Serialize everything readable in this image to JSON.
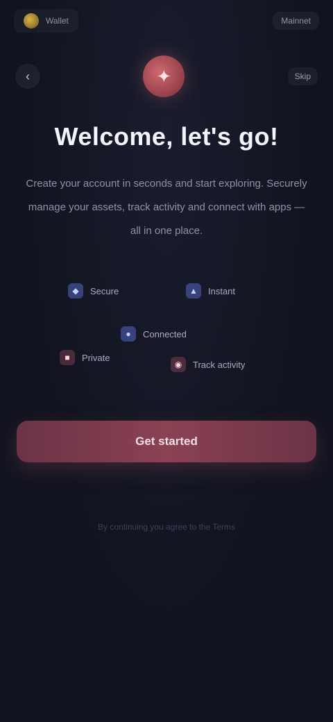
{
  "status": {
    "brand_name": "Wallet",
    "network": "Mainnet"
  },
  "nav": {
    "back_glyph": "‹",
    "logo_glyph": "✦",
    "skip_label": "Skip"
  },
  "onboarding": {
    "title": "Welcome, let's go!",
    "subtitle": "Create your account in seconds and start exploring. Securely manage your assets, track activity and connect with apps — all in one place."
  },
  "features": [
    {
      "icon": "lock-icon",
      "glyph": "◆",
      "label": "Secure"
    },
    {
      "icon": "bolt-icon",
      "glyph": "▲",
      "label": "Instant"
    },
    {
      "icon": "globe-icon",
      "glyph": "●",
      "label": "Connected"
    },
    {
      "icon": "shield-icon",
      "glyph": "■",
      "label": "Private"
    },
    {
      "icon": "chart-icon",
      "glyph": "◉",
      "label": "Track activity"
    }
  ],
  "cta": {
    "label": "Get started"
  },
  "footer": {
    "note": "By continuing you agree to the Terms"
  },
  "colors": {
    "background": "#11131f",
    "accent": "#8a4253",
    "logo": "#d0686e"
  }
}
